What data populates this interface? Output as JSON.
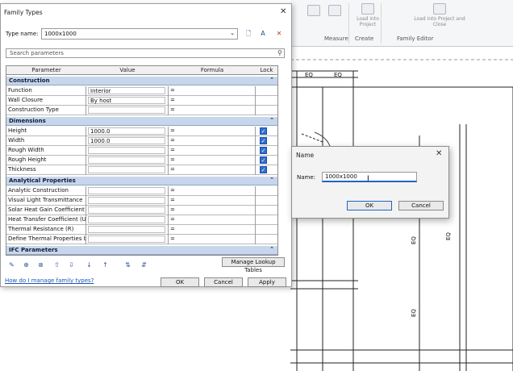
{
  "ribbon": {
    "buttons": [
      {
        "label": "Load into Project"
      },
      {
        "label": "Load into Project and Close"
      }
    ],
    "panels": [
      "Measure",
      "Create",
      "Family Editor"
    ]
  },
  "drawing": {
    "dim_labels": [
      "EQ",
      "EQ",
      "EQ",
      "EQ",
      "EQ"
    ]
  },
  "family_types": {
    "title": "Family Types",
    "close": "✕",
    "type_name_label": "Type name:",
    "type_name_value": "1000x1000",
    "search_placeholder": "Search parameters",
    "columns": [
      "Parameter",
      "Value",
      "Formula",
      "Lock"
    ],
    "sections": [
      {
        "name": "Construction",
        "rows": [
          {
            "param": "Function",
            "value": "Interior",
            "formula": "="
          },
          {
            "param": "Wall Closure",
            "value": "By host",
            "formula": "="
          },
          {
            "param": "Construction Type",
            "value": "",
            "formula": "="
          }
        ]
      },
      {
        "name": "Dimensions",
        "rows": [
          {
            "param": "Height",
            "value": "1000.0",
            "formula": "=",
            "lock": true
          },
          {
            "param": "Width",
            "value": "1000.0",
            "formula": "=",
            "lock": true
          },
          {
            "param": "Rough Width",
            "value": "",
            "formula": "=",
            "lock": true
          },
          {
            "param": "Rough Height",
            "value": "",
            "formula": "=",
            "lock": true
          },
          {
            "param": "Thickness",
            "value": "",
            "formula": "=",
            "lock": true
          }
        ]
      },
      {
        "name": "Analytical Properties",
        "rows": [
          {
            "param": "Analytic Construction",
            "value": "",
            "formula": "="
          },
          {
            "param": "Visual Light Transmittance",
            "value": "",
            "formula": "="
          },
          {
            "param": "Solar Heat Gain Coefficient",
            "value": "",
            "formula": "="
          },
          {
            "param": "Heat Transfer Coefficient (U)",
            "value": "",
            "formula": "="
          },
          {
            "param": "Thermal Resistance (R)",
            "value": "",
            "formula": "="
          },
          {
            "param": "Define Thermal Properties by",
            "value": "",
            "formula": "="
          }
        ]
      },
      {
        "name": "IFC Parameters",
        "rows": []
      }
    ],
    "manage_lookup_label": "Manage Lookup Tables",
    "help_link": "How do I manage family types?",
    "ok_label": "OK",
    "cancel_label": "Cancel",
    "apply_label": "Apply"
  },
  "name_dialog": {
    "title": "Name",
    "close": "✕",
    "label": "Name:",
    "value": "1000x1000",
    "ok_label": "OK",
    "cancel_label": "Cancel"
  }
}
